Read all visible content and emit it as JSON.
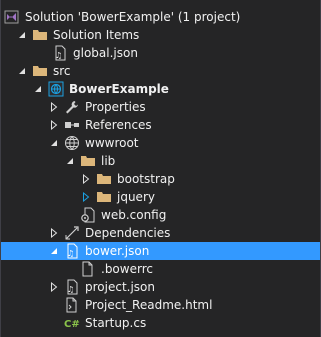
{
  "tree": {
    "solution": "Solution 'BowerExample' (1 project)",
    "solution_items": "Solution Items",
    "global_json": "global.json",
    "src": "src",
    "project": "BowerExample",
    "properties": "Properties",
    "references": "References",
    "wwwroot": "wwwroot",
    "lib": "lib",
    "bootstrap": "bootstrap",
    "jquery": "jquery",
    "web_config": "web.config",
    "dependencies": "Dependencies",
    "bower_json": "bower.json",
    "bowerrc": ".bowerrc",
    "project_json": "project.json",
    "project_readme": "Project_Readme.html",
    "startup_cs": "Startup.cs"
  },
  "colors": {
    "background": "#252526",
    "selection": "#3399ff",
    "text": "#f1f1f1",
    "folder": "#dcb67a",
    "solution_icon": "#68217a",
    "web_project": "#1ba1e2",
    "csharp": "#8bc34a"
  }
}
